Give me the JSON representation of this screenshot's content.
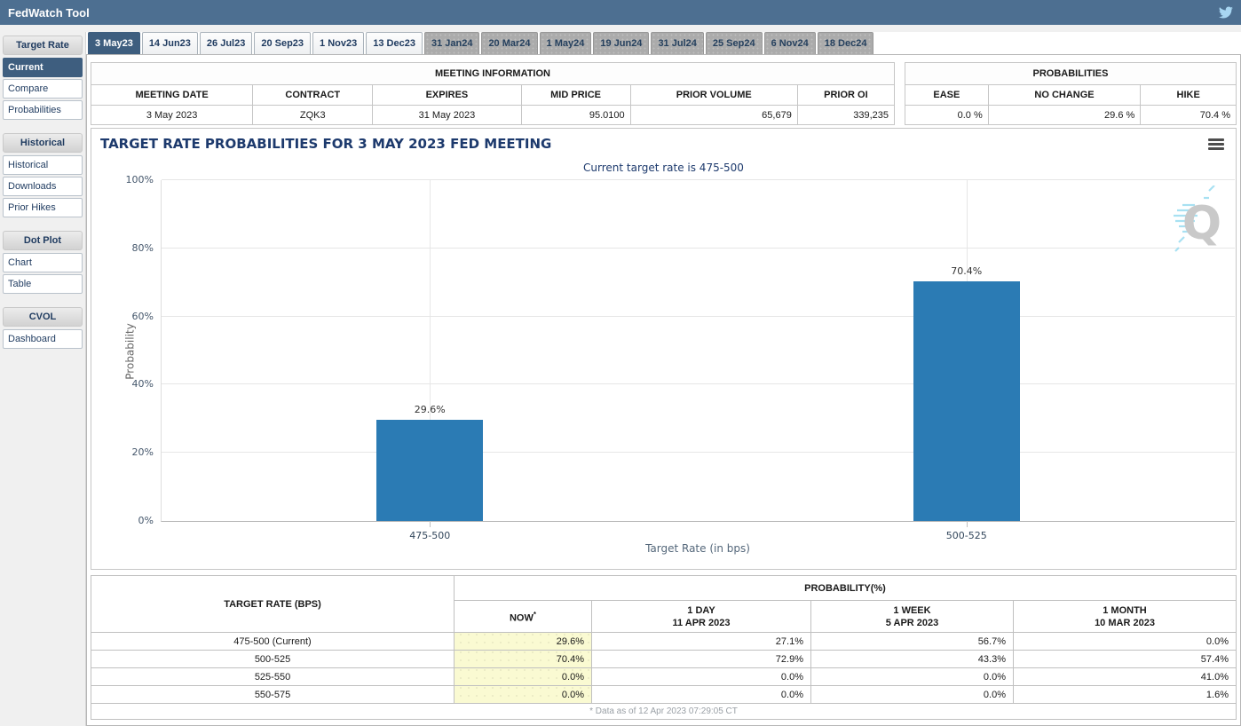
{
  "header": {
    "title": "FedWatch Tool"
  },
  "sidebar": {
    "sections": [
      {
        "header": "Target Rate",
        "items": [
          {
            "label": "Current",
            "selected": true
          },
          {
            "label": "Compare",
            "selected": false
          },
          {
            "label": "Probabilities",
            "selected": false
          }
        ]
      },
      {
        "header": "Historical",
        "items": [
          {
            "label": "Historical",
            "selected": false
          },
          {
            "label": "Downloads",
            "selected": false
          },
          {
            "label": "Prior Hikes",
            "selected": false
          }
        ]
      },
      {
        "header": "Dot Plot",
        "items": [
          {
            "label": "Chart",
            "selected": false
          },
          {
            "label": "Table",
            "selected": false
          }
        ]
      },
      {
        "header": "CVOL",
        "items": [
          {
            "label": "Dashboard",
            "selected": false
          }
        ]
      }
    ]
  },
  "tabs": [
    {
      "label": "3 May23",
      "state": "selected"
    },
    {
      "label": "14 Jun23",
      "state": "near"
    },
    {
      "label": "26 Jul23",
      "state": "near"
    },
    {
      "label": "20 Sep23",
      "state": "near"
    },
    {
      "label": "1 Nov23",
      "state": "near"
    },
    {
      "label": "13 Dec23",
      "state": "near"
    },
    {
      "label": "31 Jan24",
      "state": "far"
    },
    {
      "label": "20 Mar24",
      "state": "far"
    },
    {
      "label": "1 May24",
      "state": "far"
    },
    {
      "label": "19 Jun24",
      "state": "far"
    },
    {
      "label": "31 Jul24",
      "state": "far"
    },
    {
      "label": "25 Sep24",
      "state": "far"
    },
    {
      "label": "6 Nov24",
      "state": "far"
    },
    {
      "label": "18 Dec24",
      "state": "far"
    }
  ],
  "meeting_info": {
    "title": "MEETING INFORMATION",
    "columns": [
      "MEETING DATE",
      "CONTRACT",
      "EXPIRES",
      "MID PRICE",
      "PRIOR VOLUME",
      "PRIOR OI"
    ],
    "values": [
      "3 May 2023",
      "ZQK3",
      "31 May 2023",
      "95.0100",
      "65,679",
      "339,235"
    ]
  },
  "probabilities_summary": {
    "title": "PROBABILITIES",
    "columns": [
      "EASE",
      "NO CHANGE",
      "HIKE"
    ],
    "values": [
      "0.0 %",
      "29.6 %",
      "70.4 %"
    ]
  },
  "chart_data": {
    "type": "bar",
    "title": "TARGET RATE PROBABILITIES FOR 3 MAY 2023 FED MEETING",
    "subtitle": "Current target rate is 475-500",
    "categories": [
      "475-500",
      "500-525"
    ],
    "values": [
      29.6,
      70.4
    ],
    "xlabel": "Target Rate (in bps)",
    "ylabel": "Probability",
    "ylim": [
      0,
      100
    ],
    "yticks": [
      0,
      20,
      40,
      60,
      80,
      100
    ],
    "ytick_suffix": "%",
    "grid": true,
    "legend": "none",
    "bar_color": "#2b7bb4",
    "data_label_suffix": "%"
  },
  "watermark_letter": "Q",
  "probability_table": {
    "corner_header": "TARGET RATE (BPS)",
    "group_header": "PROBABILITY(%)",
    "columns": [
      {
        "label": "NOW",
        "sup": "*",
        "date": ""
      },
      {
        "label": "1 DAY",
        "date": "11 APR 2023"
      },
      {
        "label": "1 WEEK",
        "date": "5 APR 2023"
      },
      {
        "label": "1 MONTH",
        "date": "10 MAR 2023"
      }
    ],
    "rows": [
      {
        "rate": "475-500 (Current)",
        "now": "29.6%",
        "day": "27.1%",
        "week": "56.7%",
        "month": "0.0%"
      },
      {
        "rate": "500-525",
        "now": "70.4%",
        "day": "72.9%",
        "week": "43.3%",
        "month": "57.4%"
      },
      {
        "rate": "525-550",
        "now": "0.0%",
        "day": "0.0%",
        "week": "0.0%",
        "month": "41.0%"
      },
      {
        "rate": "550-575",
        "now": "0.0%",
        "day": "0.0%",
        "week": "0.0%",
        "month": "1.6%"
      }
    ],
    "footnote": "* Data as of 12 Apr 2023 07:29:05 CT"
  },
  "colors": {
    "titlebar": "#4d6f91",
    "selected": "#3e5e7f",
    "bar": "#2b7bb4",
    "now_cell": "#fafad2"
  }
}
